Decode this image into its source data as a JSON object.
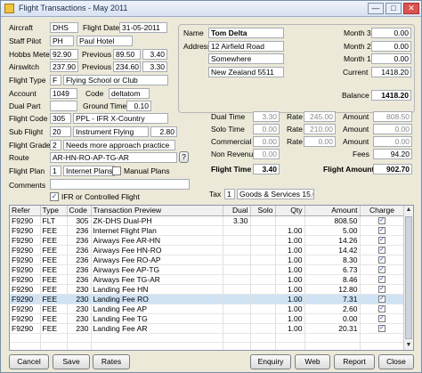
{
  "window": {
    "title": "Flight Transactions - May 2011",
    "min": "—",
    "max": "□",
    "close": "✕"
  },
  "left": {
    "aircraft_label": "Aircraft",
    "aircraft": "DHS",
    "flight_date_label": "Flight Date",
    "flight_date": "31-05-2011",
    "staff_pilot_label": "Staff Pilot",
    "staff_pilot_code": "PH",
    "staff_pilot_name": "Paul Hotel",
    "hobbs_label": "Hobbs Meter",
    "hobbs": "92.90",
    "previous_label": "Previous",
    "hobbs_prev": "89.50",
    "hobbs_diff": "3.40",
    "airswitch_label": "Airswitch",
    "airswitch": "237.90",
    "airswitch_previous_label": "Previous",
    "airswitch_prev": "234.60",
    "airswitch_diff": "3.30",
    "flight_type_label": "Flight Type",
    "flight_type_code": "F",
    "flight_type_name": "Flying School or Club",
    "account_label": "Account",
    "account": "1049",
    "code_label": "Code",
    "code": "deltatom",
    "dual_part_label": "Dual Part",
    "ground_time_label": "Ground Time",
    "ground_time": "0.10",
    "flight_code_label": "Flight Code",
    "flight_code": "305",
    "flight_code_name": "PPL - IFR X-Country",
    "sub_flight_label": "Sub Flight",
    "sub_flight": "20",
    "sub_flight_name": "Instrument Flying",
    "sub_flight_value": "2.80",
    "flight_grade_label": "Flight Grade",
    "flight_grade": "2",
    "flight_grade_name": "Needs more approach practice",
    "route_label": "Route",
    "route": "AR-HN-RO-AP-TG-AR",
    "route_help": "?",
    "flight_plan_label": "Flight Plan",
    "flight_plan": "1",
    "flight_plan_name": "Internet Plans",
    "manual_plans_label": "Manual Plans",
    "comments_label": "Comments",
    "ifr_label": "IFR or Controlled Flight"
  },
  "right": {
    "name_label": "Name",
    "name": "Tom Delta",
    "address_label": "Address",
    "address1": "12 Airfield Road",
    "address2": "Somewhere",
    "address3": "New Zealand 5511",
    "month3_label": "Month 3",
    "month3": "0.00",
    "month2_label": "Month 2",
    "month2": "0.00",
    "month1_label": "Month 1",
    "month1": "0.00",
    "current_label": "Current",
    "current": "1418.20",
    "balance_label": "Balance",
    "balance": "1418.20",
    "dual_time_label": "Dual Time",
    "dual_time": "3.30",
    "dual_rate": "245.00",
    "dual_amount": "808.50",
    "solo_time_label": "Solo Time",
    "solo_time": "0.00",
    "solo_rate": "210.00",
    "solo_amount": "0.00",
    "commercial_label": "Commercial",
    "commercial_time": "0.00",
    "commercial_rate": "0.00",
    "commercial_amount": "0.00",
    "non_revenue_label": "Non Revenue",
    "non_revenue": "0.00",
    "rate_label": "Rate",
    "amount_label": "Amount",
    "fees_label": "Fees",
    "fees": "94.20",
    "flight_time_label": "Flight Time",
    "flight_time": "3.40",
    "flight_amount_label": "Flight Amount",
    "flight_amount": "902.70",
    "tax_label": "Tax",
    "tax_code": "1",
    "tax_name": "Goods & Services 15.0%"
  },
  "grid": {
    "headers": [
      "Refer",
      "Type",
      "Code",
      "Transaction Preview",
      "Dual",
      "Solo",
      "Qty",
      "Amount",
      "Charge"
    ],
    "rows": [
      {
        "refer": "F9290",
        "type": "FLT",
        "code": "305",
        "preview": "ZK-DHS Dual-PH",
        "dual": "3.30",
        "solo": "",
        "qty": "",
        "amount": "808.50",
        "charge": true
      },
      {
        "refer": "F9290",
        "type": "FEE",
        "code": "236",
        "preview": "Internet Flight Plan",
        "dual": "",
        "solo": "",
        "qty": "1.00",
        "amount": "5.00",
        "charge": true
      },
      {
        "refer": "F9290",
        "type": "FEE",
        "code": "236",
        "preview": "Airways Fee AR-HN",
        "dual": "",
        "solo": "",
        "qty": "1.00",
        "amount": "14.26",
        "charge": true
      },
      {
        "refer": "F9290",
        "type": "FEE",
        "code": "236",
        "preview": "Airways Fee HN-RO",
        "dual": "",
        "solo": "",
        "qty": "1.00",
        "amount": "14.42",
        "charge": true
      },
      {
        "refer": "F9290",
        "type": "FEE",
        "code": "236",
        "preview": "Airways Fee RO-AP",
        "dual": "",
        "solo": "",
        "qty": "1.00",
        "amount": "8.30",
        "charge": true
      },
      {
        "refer": "F9290",
        "type": "FEE",
        "code": "236",
        "preview": "Airways Fee AP-TG",
        "dual": "",
        "solo": "",
        "qty": "1.00",
        "amount": "6.73",
        "charge": true
      },
      {
        "refer": "F9290",
        "type": "FEE",
        "code": "236",
        "preview": "Airways Fee TG-AR",
        "dual": "",
        "solo": "",
        "qty": "1.00",
        "amount": "8.46",
        "charge": true
      },
      {
        "refer": "F9290",
        "type": "FEE",
        "code": "230",
        "preview": "Landing Fee HN",
        "dual": "",
        "solo": "",
        "qty": "1.00",
        "amount": "12.80",
        "charge": true
      },
      {
        "refer": "F9290",
        "type": "FEE",
        "code": "230",
        "preview": "Landing Fee RO",
        "dual": "",
        "solo": "",
        "qty": "1.00",
        "amount": "7.31",
        "charge": true,
        "selected": true
      },
      {
        "refer": "F9290",
        "type": "FEE",
        "code": "230",
        "preview": "Landing Fee AP",
        "dual": "",
        "solo": "",
        "qty": "1.00",
        "amount": "2.60",
        "charge": true
      },
      {
        "refer": "F9290",
        "type": "FEE",
        "code": "230",
        "preview": "Landing Fee TG",
        "dual": "",
        "solo": "",
        "qty": "1.00",
        "amount": "0.00",
        "charge": true
      },
      {
        "refer": "F9290",
        "type": "FEE",
        "code": "230",
        "preview": "Landing Fee AR",
        "dual": "",
        "solo": "",
        "qty": "1.00",
        "amount": "20.31",
        "charge": true
      },
      {
        "refer": "",
        "type": "",
        "code": "",
        "preview": "",
        "dual": "",
        "solo": "",
        "qty": "",
        "amount": "",
        "charge": false
      },
      {
        "refer": "",
        "type": "",
        "code": "",
        "preview": "",
        "dual": "",
        "solo": "",
        "qty": "",
        "amount": "",
        "charge": false
      }
    ]
  },
  "buttons": {
    "cancel": "Cancel",
    "save": "Save",
    "rates": "Rates",
    "enquiry": "Enquiry",
    "web": "Web",
    "report": "Report",
    "close": "Close"
  },
  "icons": {
    "app": "app-icon",
    "check": "✓"
  },
  "colors": {
    "selected_row": "#cfe3f5",
    "window_bg": "#ece9d8"
  }
}
